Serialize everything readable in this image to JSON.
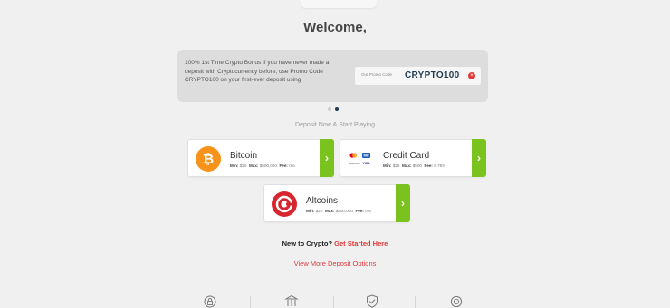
{
  "welcome": "Welcome,",
  "promo": {
    "text": "100% 1st Time Crypto Bonus If you have never made a deposit with Cryptocurrency before, use Promo Code CRYPTO100 on your first-ever deposit using",
    "code_label": "Our Promo Code",
    "code_value": "CRYPTO100",
    "close_glyph": "×"
  },
  "deposit_now": "Deposit Now & Start Playing",
  "methods": {
    "bitcoin": {
      "title": "Bitcoin",
      "min_label": "Min:",
      "min": "$20",
      "max_label": "Max:",
      "max": "$500,000",
      "fee_label": "Fee:",
      "fee": "0%",
      "icon": "bitcoin-icon"
    },
    "credit_card": {
      "title": "Credit Card",
      "min_label": "Min:",
      "min": "$25",
      "max_label": "Max:",
      "max": "$500",
      "fee_label": "Fee:",
      "fee": "9.75%",
      "icon": "credit-card-logos-icon",
      "logo_labels": [
        "mastercard",
        "VISA"
      ]
    },
    "altcoins": {
      "title": "Altcoins",
      "min_label": "Min:",
      "min": "$20",
      "max_label": "Max:",
      "max": "$500,000",
      "fee_label": "Fee:",
      "fee": "0%",
      "icon": "altcoins-icon"
    }
  },
  "go_glyph": "›",
  "new_to_crypto": {
    "prefix": "New to Crypto?",
    "link": "Get Started Here"
  },
  "view_more": "View More Deposit Options",
  "colors": {
    "accent_green": "#7ac21e",
    "bitcoin_orange": "#f7931a",
    "altcoin_red": "#d7262e",
    "link_red": "#e03a3a",
    "promo_code": "#1f3b4d"
  }
}
